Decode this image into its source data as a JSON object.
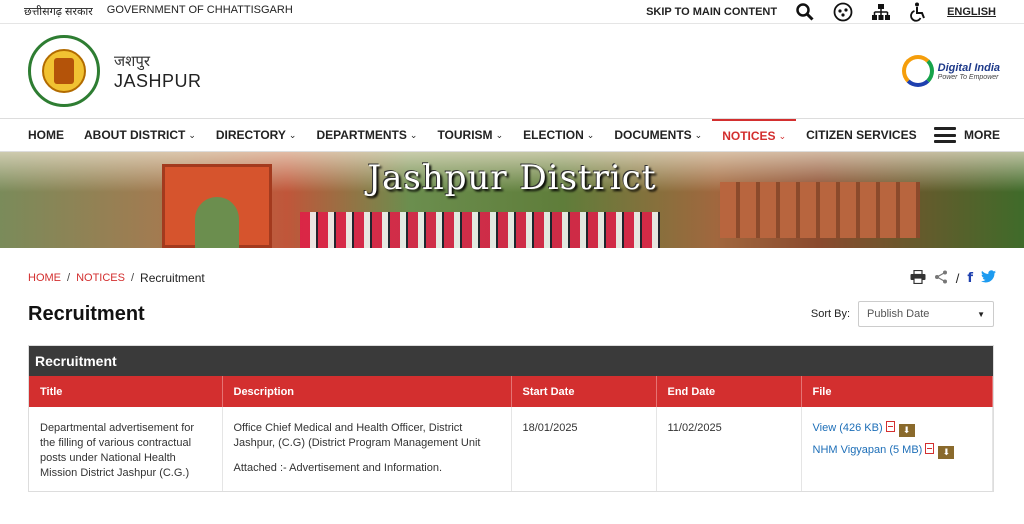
{
  "topbar": {
    "state_govt_hi": "छत्तीसगढ़ सरकार",
    "govt_en": "GOVERNMENT OF CHHATTISGARH",
    "skip_link": "SKIP TO MAIN CONTENT",
    "language": "ENGLISH",
    "icons": [
      "search-icon",
      "social-media-icon",
      "sitemap-icon",
      "accessibility-icon"
    ]
  },
  "header": {
    "district_hi": "जशपुर",
    "district_en": "JASHPUR",
    "digital_india_title": "Digital India",
    "digital_india_tagline": "Power To Empower"
  },
  "nav": {
    "items": [
      {
        "label": "HOME",
        "dropdown": false
      },
      {
        "label": "ABOUT DISTRICT",
        "dropdown": true
      },
      {
        "label": "DIRECTORY",
        "dropdown": true
      },
      {
        "label": "DEPARTMENTS",
        "dropdown": true
      },
      {
        "label": "TOURISM",
        "dropdown": true
      },
      {
        "label": "ELECTION",
        "dropdown": true
      },
      {
        "label": "DOCUMENTS",
        "dropdown": true
      },
      {
        "label": "NOTICES",
        "dropdown": true,
        "active": true
      },
      {
        "label": "CITIZEN SERVICES",
        "dropdown": false
      }
    ],
    "more_label": "MORE"
  },
  "banner": {
    "title": "Jashpur District"
  },
  "breadcrumb": {
    "home": "HOME",
    "notices": "NOTICES",
    "current": "Recruitment"
  },
  "page": {
    "title": "Recruitment",
    "sort_label": "Sort By:",
    "sort_value": "Publish Date"
  },
  "table": {
    "caption": "Recruitment",
    "headers": [
      "Title",
      "Description",
      "Start Date",
      "End Date",
      "File"
    ],
    "rows": [
      {
        "title": "Departmental advertisement for the filling of various contractual posts under National Health Mission District Jashpur (C.G.)",
        "description_1": "Office Chief Medical and Health Officer, District Jashpur, (C.G) (District Program Management Unit",
        "description_2": "Attached :- Advertisement and Information.",
        "start_date": "18/01/2025",
        "end_date": "11/02/2025",
        "files": [
          {
            "label": "View (426 KB)"
          },
          {
            "label": "NHM Vigyapan (5 MB)"
          }
        ]
      }
    ]
  },
  "colors": {
    "accent_red": "#d32f2f",
    "caption_dark": "#3a3a3a",
    "link_blue": "#1e6fb8"
  }
}
